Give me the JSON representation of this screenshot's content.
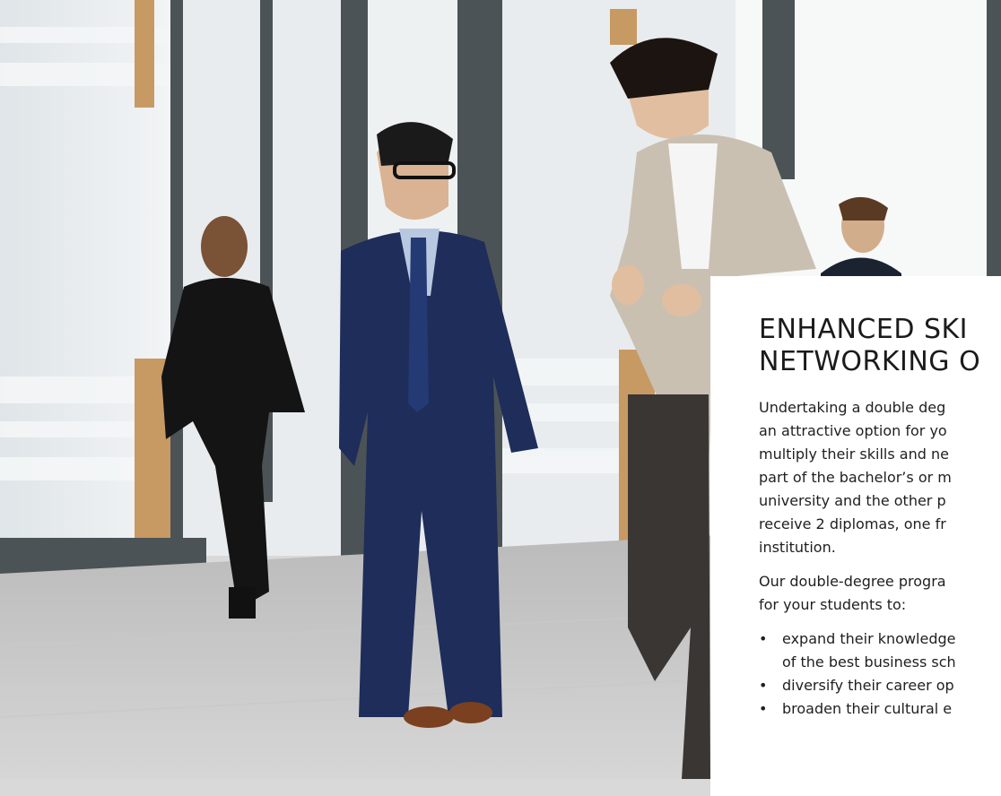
{
  "photo": {
    "subject": "photo-scene"
  },
  "panel": {
    "heading_lines": [
      "ENHANCED SKI",
      "NETWORKING O"
    ],
    "paragraph1_lines": [
      "Undertaking a double deg",
      "an attractive option for yo",
      "multiply their skills and ne",
      "part of the bachelor’s or m",
      "university and the other p",
      "receive 2 diplomas, one fr",
      "institution."
    ],
    "paragraph2_lines": [
      "Our double-degree progra",
      "for your students to:"
    ],
    "bullet_glyph": "•",
    "bullets": [
      {
        "lines": [
          "expand their knowledge",
          "of the best business sch"
        ]
      },
      {
        "lines": [
          "diversify their career op"
        ]
      },
      {
        "lines": [
          "broaden their cultural e"
        ]
      }
    ]
  },
  "colors": {
    "panel_bg": "#ffffff",
    "text": "#1f1f1f"
  }
}
